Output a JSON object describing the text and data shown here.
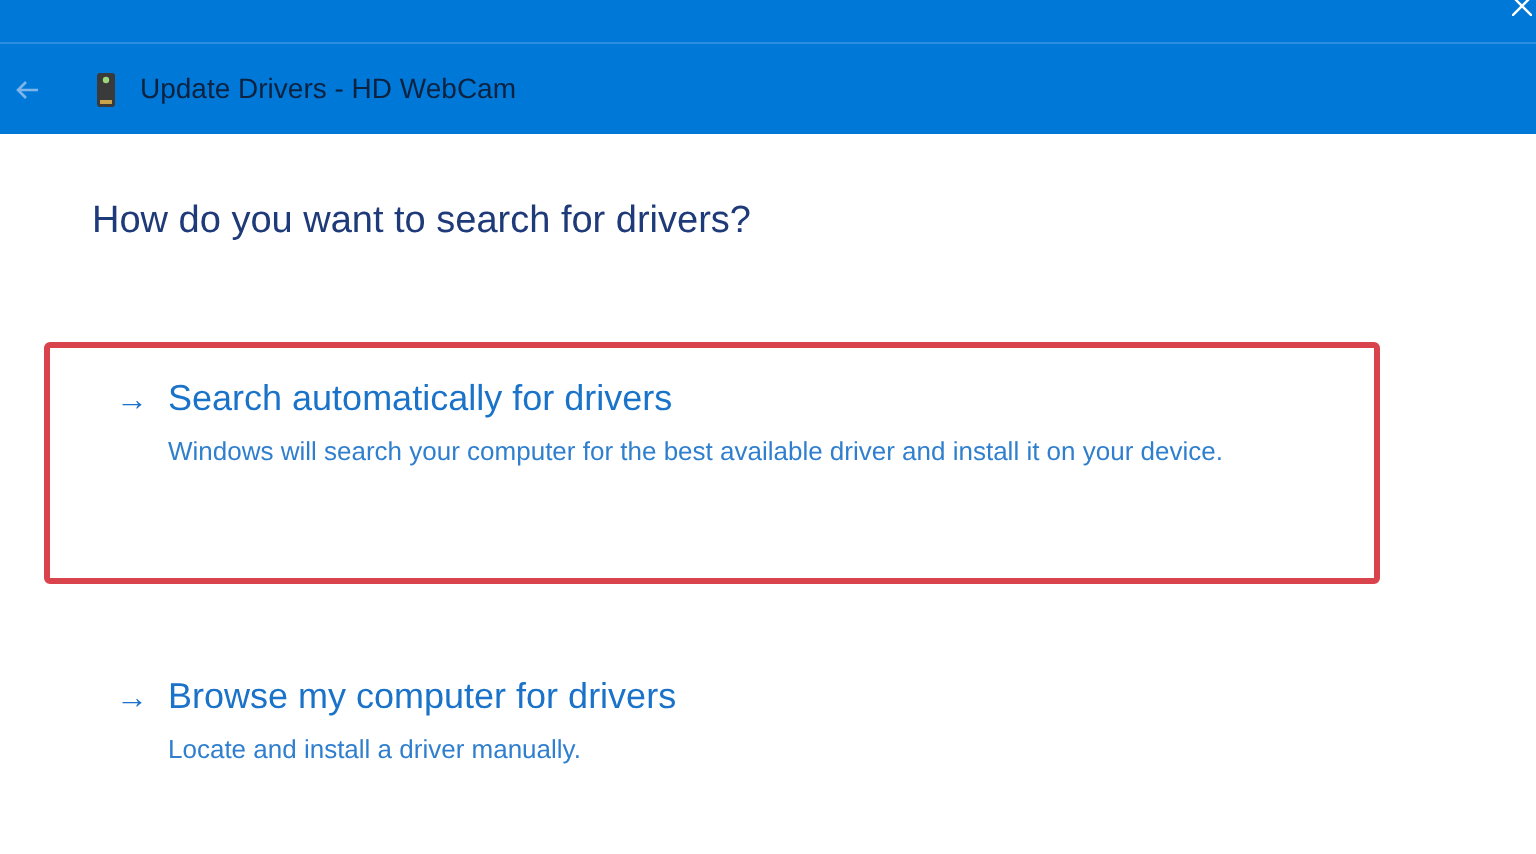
{
  "window": {
    "title": "Update Drivers - HD WebCam",
    "back_disabled": true
  },
  "heading": "How do you want to search for drivers?",
  "options": [
    {
      "arrow": "→",
      "title": "Search automatically for drivers",
      "description": "Windows will search your computer for the best available driver and install it on your device.",
      "highlighted": true
    },
    {
      "arrow": "→",
      "title": "Browse my computer for drivers",
      "description": "Locate and install a driver manually.",
      "highlighted": false
    }
  ]
}
